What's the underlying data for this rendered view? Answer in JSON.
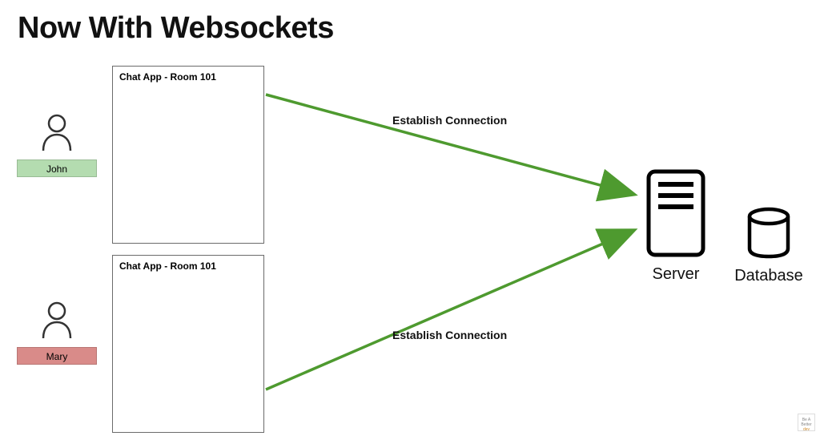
{
  "title": "Now With Websockets",
  "users": [
    {
      "name": "John",
      "color": "#b4dcb0"
    },
    {
      "name": "Mary",
      "color": "#d98b89"
    }
  ],
  "chat": {
    "title": "Chat App - Room 101"
  },
  "connections": [
    {
      "label": "Establish Connection"
    },
    {
      "label": "Establish Connection"
    }
  ],
  "server": {
    "label": "Server"
  },
  "database": {
    "label": "Database"
  },
  "watermark": {
    "line1": "Be A",
    "line2": "Better",
    "line3": "dev"
  },
  "colors": {
    "arrow": "#4e9a2f"
  }
}
